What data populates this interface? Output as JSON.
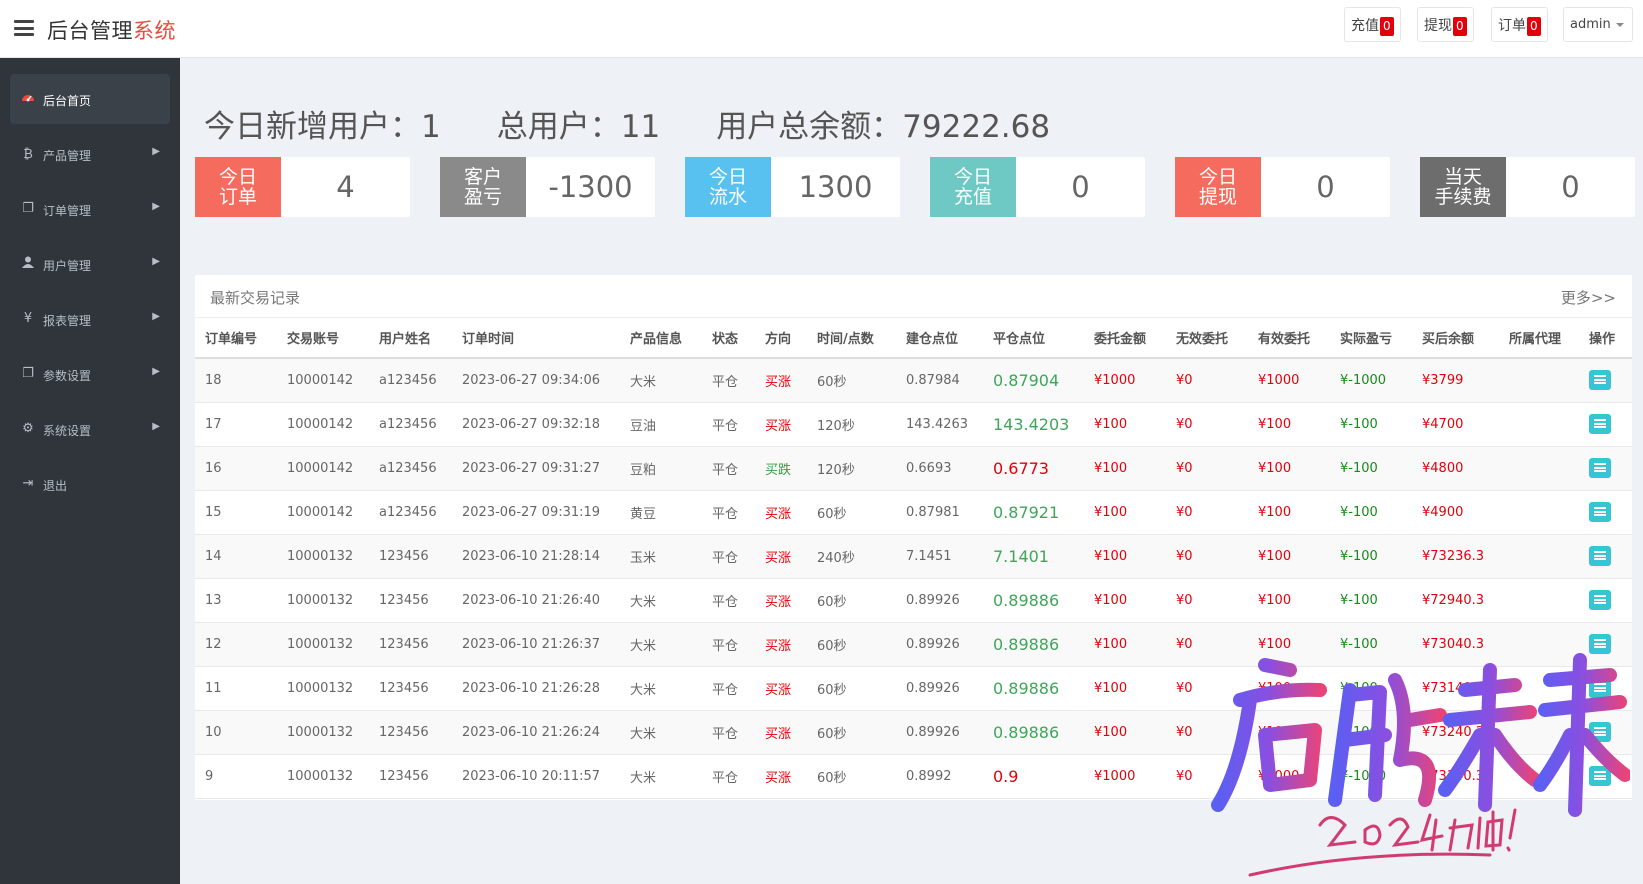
{
  "header": {
    "brand_main": "后台管理",
    "brand_accent": "系统",
    "recharge_label": "充值",
    "recharge_count": "0",
    "withdraw_label": "提现",
    "withdraw_count": "0",
    "order_label": "订单",
    "order_count": "0",
    "user": "admin"
  },
  "sidebar": {
    "items": [
      {
        "label": "后台首页",
        "icon": "dashboard-icon"
      },
      {
        "label": "产品管理",
        "icon": "bitcoin-icon"
      },
      {
        "label": "订单管理",
        "icon": "copy-icon"
      },
      {
        "label": "用户管理",
        "icon": "user-icon"
      },
      {
        "label": "报表管理",
        "icon": "yen-icon"
      },
      {
        "label": "参数设置",
        "icon": "copy-icon"
      },
      {
        "label": "系统设置",
        "icon": "gears-icon"
      },
      {
        "label": "退出",
        "icon": "sign-out-icon"
      }
    ]
  },
  "summary": {
    "new_users": "今日新增用户：1",
    "total_users": "总用户：11",
    "total_balance": "用户总余额：79222.68"
  },
  "cards": [
    {
      "line1": "今日",
      "line2": "订单",
      "value": "4",
      "color": "#f56b5d"
    },
    {
      "line1": "客户",
      "line2": "盈亏",
      "value": "-1300",
      "color": "#8a8a8a"
    },
    {
      "line1": "今日",
      "line2": "流水",
      "value": "1300",
      "color": "#58c1f0"
    },
    {
      "line1": "今日",
      "line2": "充值",
      "value": "0",
      "color": "#6ec9c4"
    },
    {
      "line1": "今日",
      "line2": "提现",
      "value": "0",
      "color": "#f56b5d"
    },
    {
      "line1": "当天",
      "line2": "手续费",
      "value": "0",
      "color": "#6d6d6d"
    }
  ],
  "table": {
    "title": "最新交易记录",
    "more": "更多>>",
    "columns": [
      "订单编号",
      "交易账号",
      "用户姓名",
      "订单时间",
      "产品信息",
      "状态",
      "方向",
      "时间/点数",
      "建仓点位",
      "平仓点位",
      "委托金额",
      "无效委托",
      "有效委托",
      "实际盈亏",
      "买后余额",
      "所属代理",
      "操作"
    ],
    "rows": [
      [
        "18",
        "10000142",
        "a123456",
        "2023-06-27 09:34:06",
        "大米",
        "平仓",
        "买涨",
        "60秒",
        "0.87984",
        "0.87904",
        "¥1000",
        "¥0",
        "¥1000",
        "¥-1000",
        "¥3799",
        ""
      ],
      [
        "17",
        "10000142",
        "a123456",
        "2023-06-27 09:32:18",
        "豆油",
        "平仓",
        "买涨",
        "120秒",
        "143.4263",
        "143.4203",
        "¥100",
        "¥0",
        "¥100",
        "¥-100",
        "¥4700",
        ""
      ],
      [
        "16",
        "10000142",
        "a123456",
        "2023-06-27 09:31:27",
        "豆粕",
        "平仓",
        "买跌",
        "120秒",
        "0.6693",
        "0.6773",
        "¥100",
        "¥0",
        "¥100",
        "¥-100",
        "¥4800",
        ""
      ],
      [
        "15",
        "10000142",
        "a123456",
        "2023-06-27 09:31:19",
        "黄豆",
        "平仓",
        "买涨",
        "60秒",
        "0.87981",
        "0.87921",
        "¥100",
        "¥0",
        "¥100",
        "¥-100",
        "¥4900",
        ""
      ],
      [
        "14",
        "10000132",
        "123456",
        "2023-06-10 21:28:14",
        "玉米",
        "平仓",
        "买涨",
        "240秒",
        "7.1451",
        "7.1401",
        "¥100",
        "¥0",
        "¥100",
        "¥-100",
        "¥73236.3",
        ""
      ],
      [
        "13",
        "10000132",
        "123456",
        "2023-06-10 21:26:40",
        "大米",
        "平仓",
        "买涨",
        "60秒",
        "0.89926",
        "0.89886",
        "¥100",
        "¥0",
        "¥100",
        "¥-100",
        "¥72940.3",
        ""
      ],
      [
        "12",
        "10000132",
        "123456",
        "2023-06-10 21:26:37",
        "大米",
        "平仓",
        "买涨",
        "60秒",
        "0.89926",
        "0.89886",
        "¥100",
        "¥0",
        "¥100",
        "¥-100",
        "¥73040.3",
        ""
      ],
      [
        "11",
        "10000132",
        "123456",
        "2023-06-10 21:26:28",
        "大米",
        "平仓",
        "买涨",
        "60秒",
        "0.89926",
        "0.89886",
        "¥100",
        "¥0",
        "¥100",
        "¥-100",
        "¥73140.3",
        ""
      ],
      [
        "10",
        "10000132",
        "123456",
        "2023-06-10 21:26:24",
        "大米",
        "平仓",
        "买涨",
        "60秒",
        "0.89926",
        "0.89886",
        "¥100",
        "¥0",
        "¥100",
        "¥-100",
        "¥73240.3",
        ""
      ],
      [
        "9",
        "10000132",
        "123456",
        "2023-06-10 20:11:57",
        "大米",
        "平仓",
        "买涨",
        "60秒",
        "0.8992",
        "0.9",
        "¥1000",
        "¥0",
        "¥1000",
        "¥-1000",
        "¥73340.3",
        ""
      ]
    ]
  },
  "watermark": {
    "main": "启航未来",
    "sub": "2024加油!"
  }
}
